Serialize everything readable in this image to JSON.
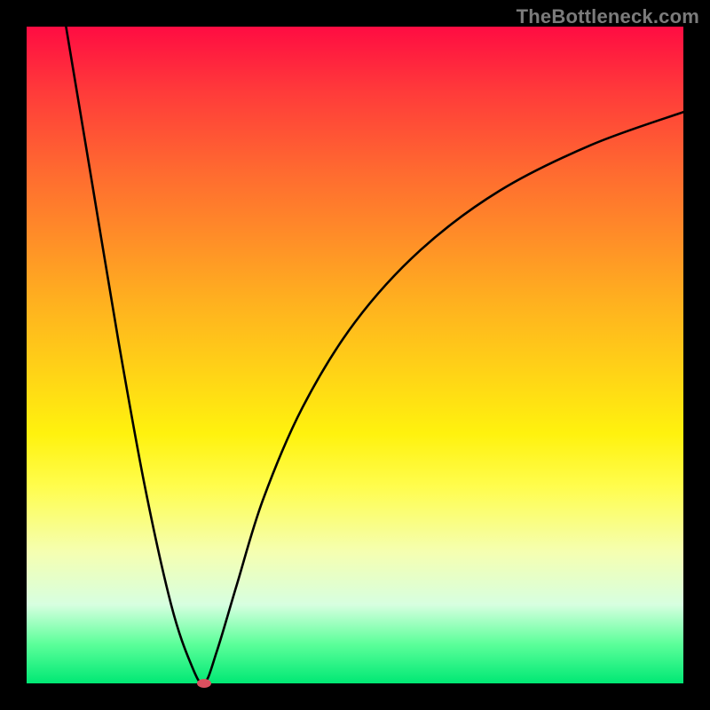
{
  "watermark": "TheBottleneck.com",
  "chart_data": {
    "type": "line",
    "title": "",
    "xlabel": "",
    "ylabel": "",
    "xlim": [
      0,
      100
    ],
    "ylim": [
      0,
      100
    ],
    "marker": {
      "x": 27,
      "y": 0
    },
    "series": [
      {
        "name": "left-branch",
        "x": [
          6,
          10,
          14,
          18,
          22,
          25,
          27
        ],
        "values": [
          100,
          76,
          52,
          30,
          12,
          3,
          0
        ]
      },
      {
        "name": "right-branch",
        "x": [
          27,
          29,
          32,
          36,
          42,
          50,
          60,
          72,
          86,
          100
        ],
        "values": [
          0,
          5,
          15,
          28,
          42,
          55,
          66,
          75,
          82,
          87
        ]
      }
    ],
    "gradient_stops": [
      {
        "pos": 0,
        "color": "#ff0c42"
      },
      {
        "pos": 10,
        "color": "#ff3b3a"
      },
      {
        "pos": 22,
        "color": "#ff6a30"
      },
      {
        "pos": 32,
        "color": "#ff8d28"
      },
      {
        "pos": 42,
        "color": "#ffb11f"
      },
      {
        "pos": 52,
        "color": "#ffd117"
      },
      {
        "pos": 62,
        "color": "#fff20e"
      },
      {
        "pos": 70,
        "color": "#fffd4d"
      },
      {
        "pos": 80,
        "color": "#f5ffb1"
      },
      {
        "pos": 88,
        "color": "#d7ffe0"
      },
      {
        "pos": 94,
        "color": "#5cff9a"
      },
      {
        "pos": 100,
        "color": "#00e874"
      }
    ]
  }
}
